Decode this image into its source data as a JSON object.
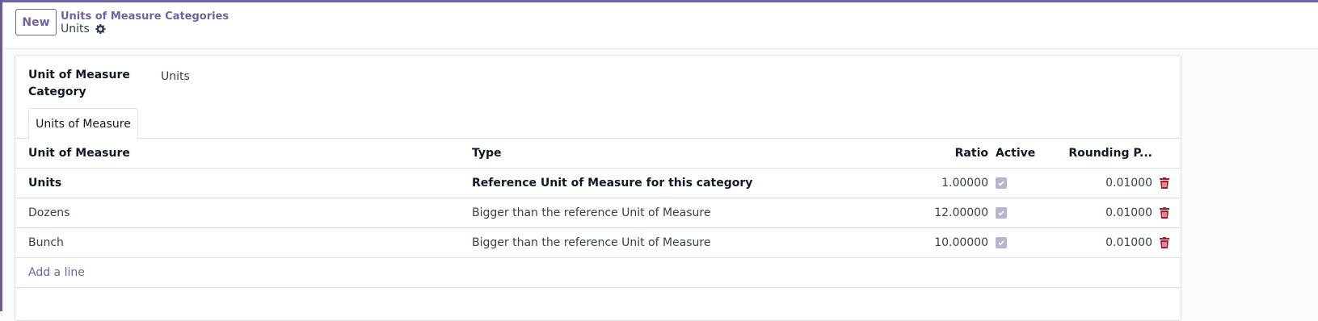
{
  "control_panel": {
    "new_label": "New",
    "breadcrumb": "Units of Measure Categories",
    "record_title": "Units"
  },
  "form": {
    "category_label": "Unit of Measure Category",
    "category_value": "Units",
    "tab_label": "Units of Measure"
  },
  "table": {
    "columns": {
      "name": "Unit of Measure",
      "type": "Type",
      "ratio": "Ratio",
      "active": "Active",
      "rounding": "Rounding P..."
    },
    "rows": [
      {
        "name": "Units",
        "type": "Reference Unit of Measure for this category",
        "ratio": "1.00000",
        "active": true,
        "rounding": "0.01000"
      },
      {
        "name": "Dozens",
        "type": "Bigger than the reference Unit of Measure",
        "ratio": "12.00000",
        "active": true,
        "rounding": "0.01000"
      },
      {
        "name": "Bunch",
        "type": "Bigger than the reference Unit of Measure",
        "ratio": "10.00000",
        "active": true,
        "rounding": "0.01000"
      }
    ],
    "add_line_label": "Add a line"
  },
  "colors": {
    "accent": "#71639e",
    "danger": "#a51d2d"
  },
  "icons": {
    "gear": "gear-icon",
    "trash": "trash-icon",
    "check": "check-icon"
  }
}
